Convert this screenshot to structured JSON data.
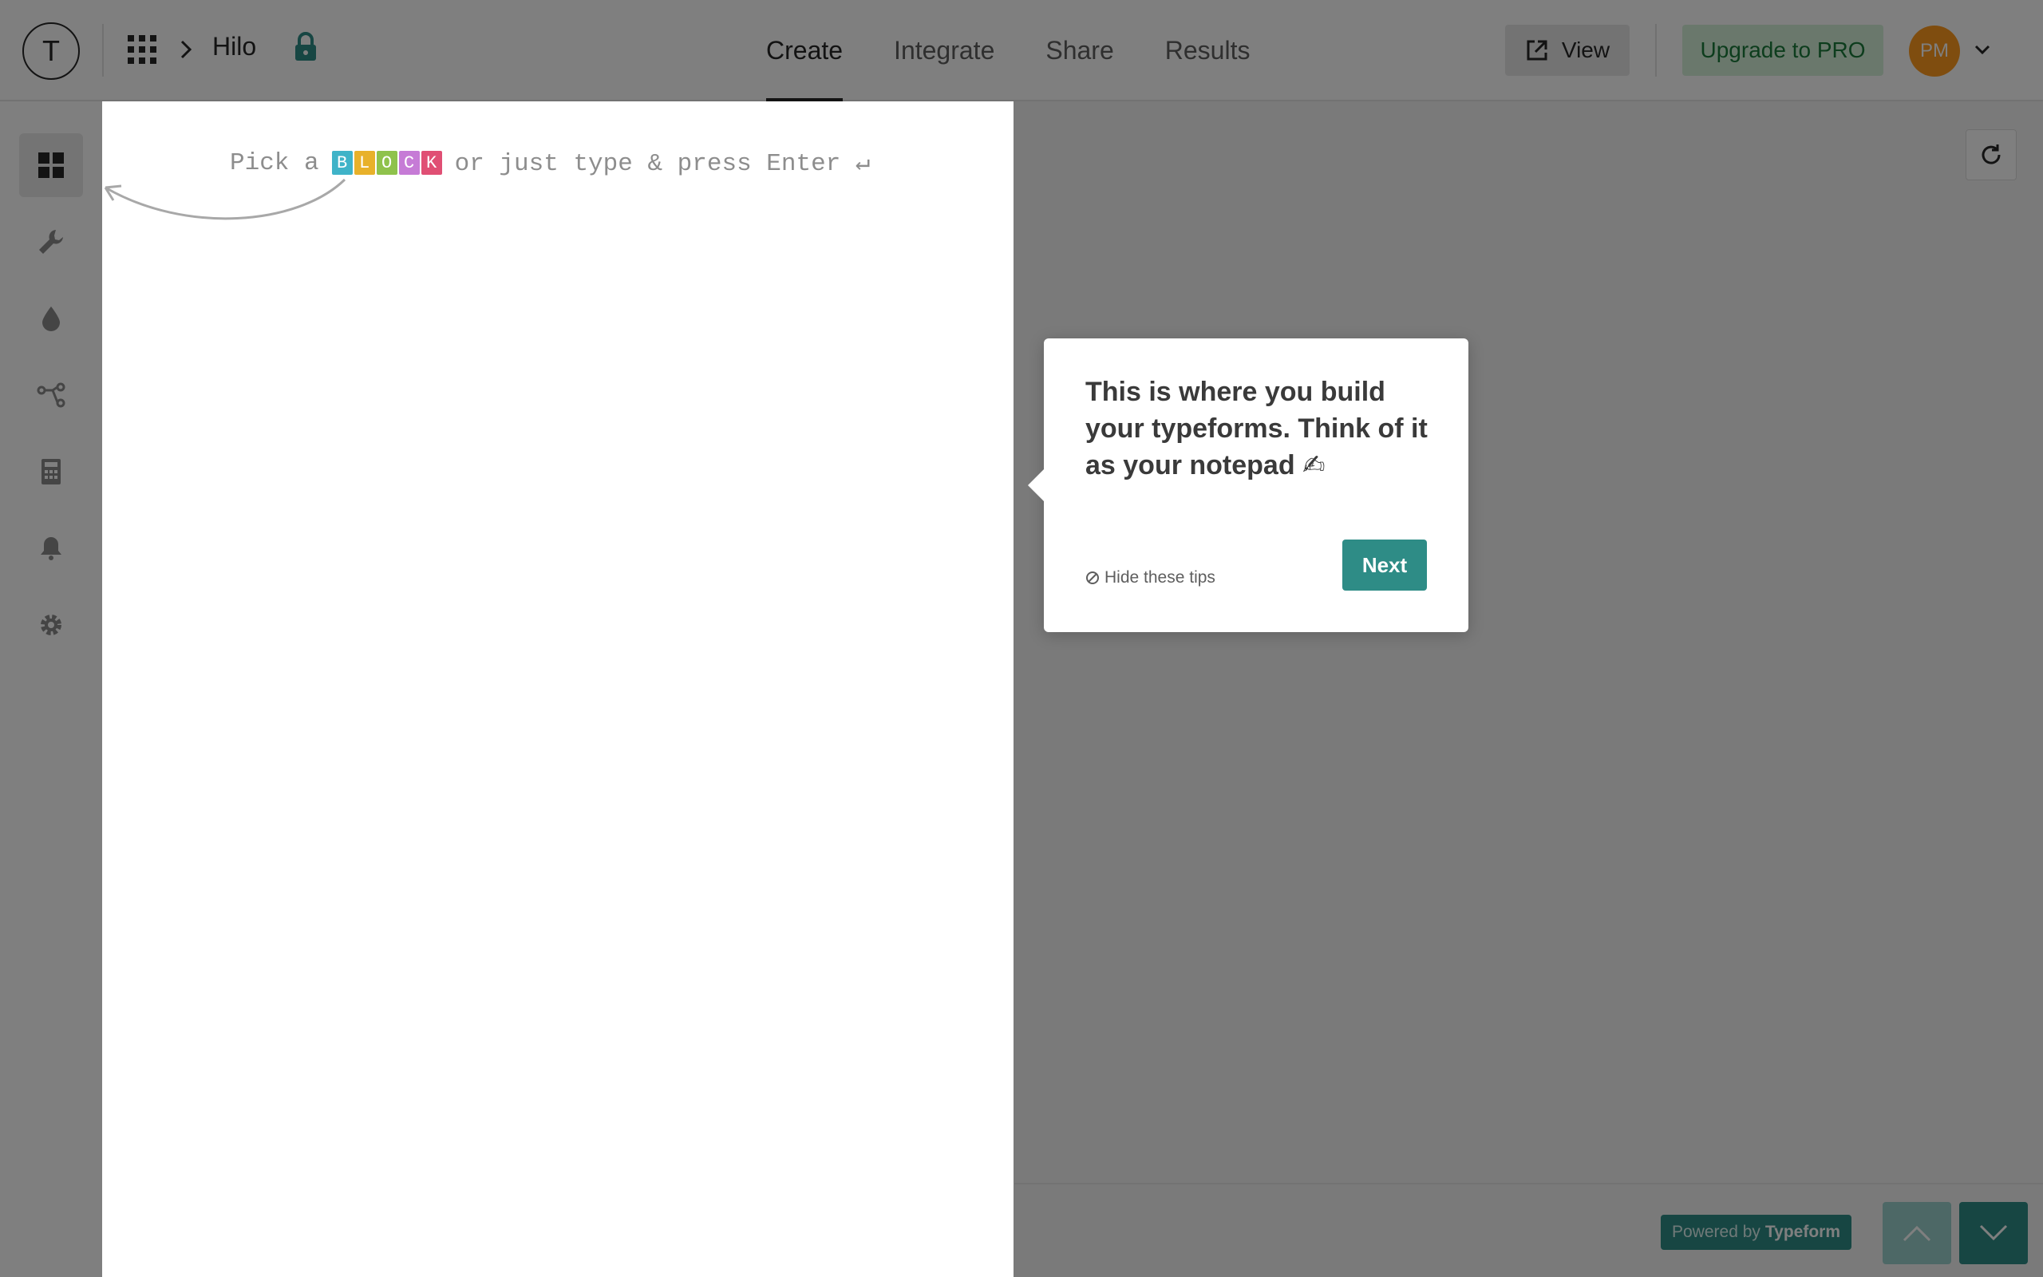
{
  "app": {
    "logo_letter": "T",
    "form_title": "Hilo"
  },
  "tabs": [
    {
      "label": "Create",
      "active": true
    },
    {
      "label": "Integrate",
      "active": false
    },
    {
      "label": "Share",
      "active": false
    },
    {
      "label": "Results",
      "active": false
    }
  ],
  "header": {
    "view_label": "View",
    "upgrade_label": "Upgrade to PRO",
    "avatar_initials": "PM",
    "avatar_color": "#ff9a1f"
  },
  "sidebar": {
    "items": [
      {
        "icon": "blocks-icon",
        "active": true
      },
      {
        "icon": "wrench-icon",
        "active": false
      },
      {
        "icon": "drop-icon",
        "active": false
      },
      {
        "icon": "logic-jump-icon",
        "active": false
      },
      {
        "icon": "calculator-icon",
        "active": false
      },
      {
        "icon": "bell-icon",
        "active": false
      },
      {
        "icon": "gear-icon",
        "active": false
      }
    ]
  },
  "canvas": {
    "hint_prefix": "Pick a",
    "hint_suffix": "or just type & press Enter ↵",
    "blocks": [
      {
        "letter": "B",
        "color": "#3fb3c8"
      },
      {
        "letter": "L",
        "color": "#e8b12a"
      },
      {
        "letter": "O",
        "color": "#8fc24c"
      },
      {
        "letter": "C",
        "color": "#c67bd6"
      },
      {
        "letter": "K",
        "color": "#e04f74"
      }
    ]
  },
  "tip": {
    "text": "This is where you build your typeforms. Think of it as your notepad ✍",
    "hide_label": "Hide these tips",
    "next_label": "Next"
  },
  "preview": {
    "powered_prefix": "Powered by",
    "powered_brand": "Typeform"
  },
  "colors": {
    "accent": "#2e8c86",
    "overlay": "rgba(0,0,0,0.5)"
  }
}
